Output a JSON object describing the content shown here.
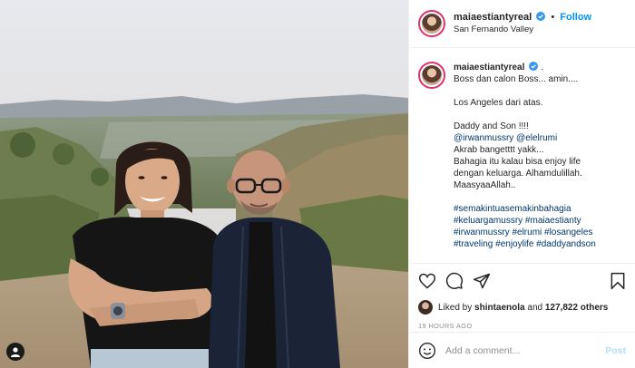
{
  "post": {
    "image_alt": "Two men posing outdoors on a hillside overlooking a valley",
    "user_tag_icon": "user-tag-icon"
  },
  "header": {
    "username": "maiaestiantyreal",
    "separator": "•",
    "follow_label": "Follow",
    "location": "San Fernando Valley",
    "verified_icon": "verified-badge-icon"
  },
  "caption": {
    "username": "maiaestiantyreal",
    "trailing": ".",
    "lines": [
      {
        "text": "Boss dan calon Boss... amin....",
        "kind": "text"
      },
      {
        "text": "",
        "kind": "blank"
      },
      {
        "text": "Los Angeles dari atas.",
        "kind": "text"
      },
      {
        "text": "",
        "kind": "blank"
      },
      {
        "text": "Daddy and Son !!!!",
        "kind": "text"
      },
      {
        "text": "@irwanmussry @elelrumi",
        "kind": "link"
      },
      {
        "text": "Akrab bangetttt yakk...",
        "kind": "text"
      },
      {
        "text": "Bahagia itu kalau bisa enjoy life",
        "kind": "text"
      },
      {
        "text": "dengan keluarga. Alhamdulillah.",
        "kind": "text"
      },
      {
        "text": "MaasyaaAllah..",
        "kind": "text"
      },
      {
        "text": "",
        "kind": "blank"
      },
      {
        "text": "#semakintuasemakinbahagia",
        "kind": "link"
      },
      {
        "text": "#keluargamussry #maiaestianty",
        "kind": "link"
      },
      {
        "text": "#irwanmussry #elrumi #losangeles",
        "kind": "link"
      },
      {
        "text": "#traveling #enjoylife #daddyandson",
        "kind": "link"
      }
    ]
  },
  "actions": {
    "like_icon": "heart-icon",
    "comment_icon": "comment-icon",
    "share_icon": "share-icon",
    "save_icon": "bookmark-icon"
  },
  "likes": {
    "prefix": "Liked by ",
    "user": "shintaenola",
    "middle": " and ",
    "others": "127,822 others"
  },
  "timestamp": "19 HOURS AGO",
  "comment_box": {
    "placeholder": "Add a comment...",
    "post_label": "Post",
    "emoji_icon": "emoji-icon"
  },
  "colors": {
    "follow_blue": "#0095f6",
    "link_blue": "#00376b",
    "post_disabled": "#b2dffc",
    "story_ring": "#e1306c"
  }
}
